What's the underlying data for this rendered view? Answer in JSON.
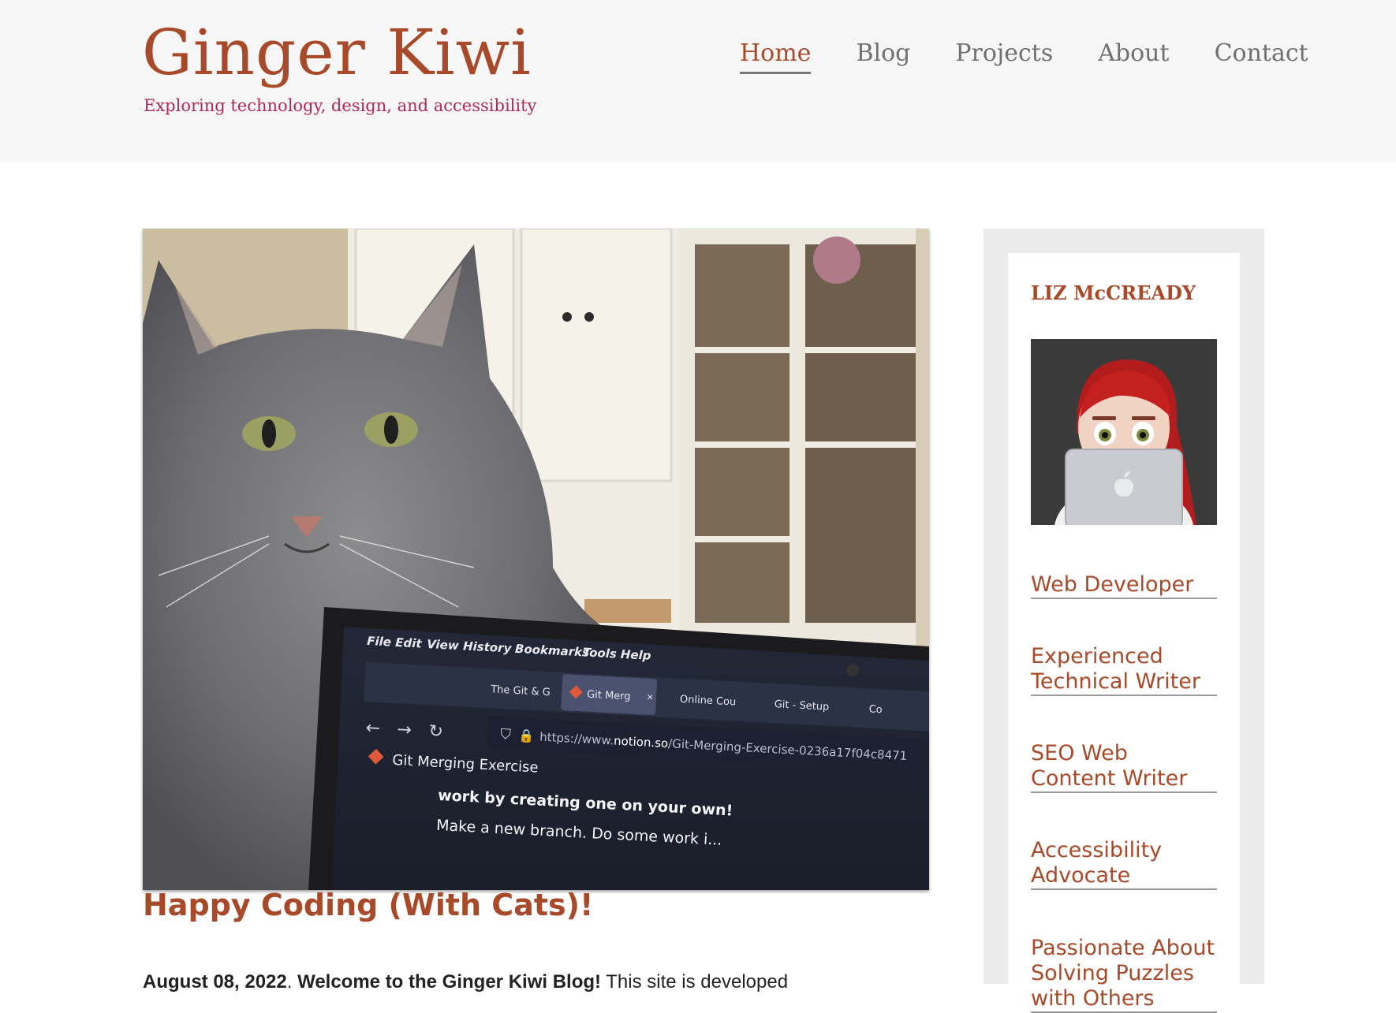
{
  "site": {
    "title": "Ginger Kiwi",
    "tagline": "Exploring technology, design, and accessibility"
  },
  "nav": {
    "items": [
      {
        "label": "Home",
        "active": true
      },
      {
        "label": "Blog",
        "active": false
      },
      {
        "label": "Projects",
        "active": false
      },
      {
        "label": "About",
        "active": false
      },
      {
        "label": "Contact",
        "active": false
      }
    ]
  },
  "post": {
    "title": "Happy Coding (With Cats)!",
    "date": "August 08, 2022",
    "greeting": "Welcome to the Ginger Kiwi Blog!",
    "intro": "This site is developed"
  },
  "hero_screen": {
    "menu": [
      "File",
      "Edit",
      "View",
      "History",
      "Bookmarks",
      "Tools",
      "Help"
    ],
    "tabs": [
      "The Git & G",
      "Git Merg",
      "Online Cou",
      "Git - Setup",
      "Co"
    ],
    "url_prefix": "https://www.",
    "url_domain": "notion.so",
    "url_path": "/Git-Merging-Exercise-0236a17f04c8471",
    "page_heading": "Git Merging Exercise",
    "line1": "work by creating one on your own!",
    "line2": "Make a new branch. Do some work i..."
  },
  "sidebar": {
    "author": "LIZ McCREADY",
    "roles": [
      "Web Developer",
      "Experienced Technical Writer",
      "SEO Web Content Writer",
      "Accessibility Advocate",
      "Passionate About Solving Puzzles with Others"
    ]
  },
  "colors": {
    "brand": "#a84a2a",
    "tagline": "#b0285a",
    "header_bg": "#f6f6f6",
    "sidebar_bg": "#ebebeb"
  },
  "icons": [
    "apple-logo-icon",
    "close-icon",
    "back-arrow-icon",
    "forward-arrow-icon",
    "reload-icon",
    "shield-icon",
    "lock-icon",
    "git-icon"
  ]
}
